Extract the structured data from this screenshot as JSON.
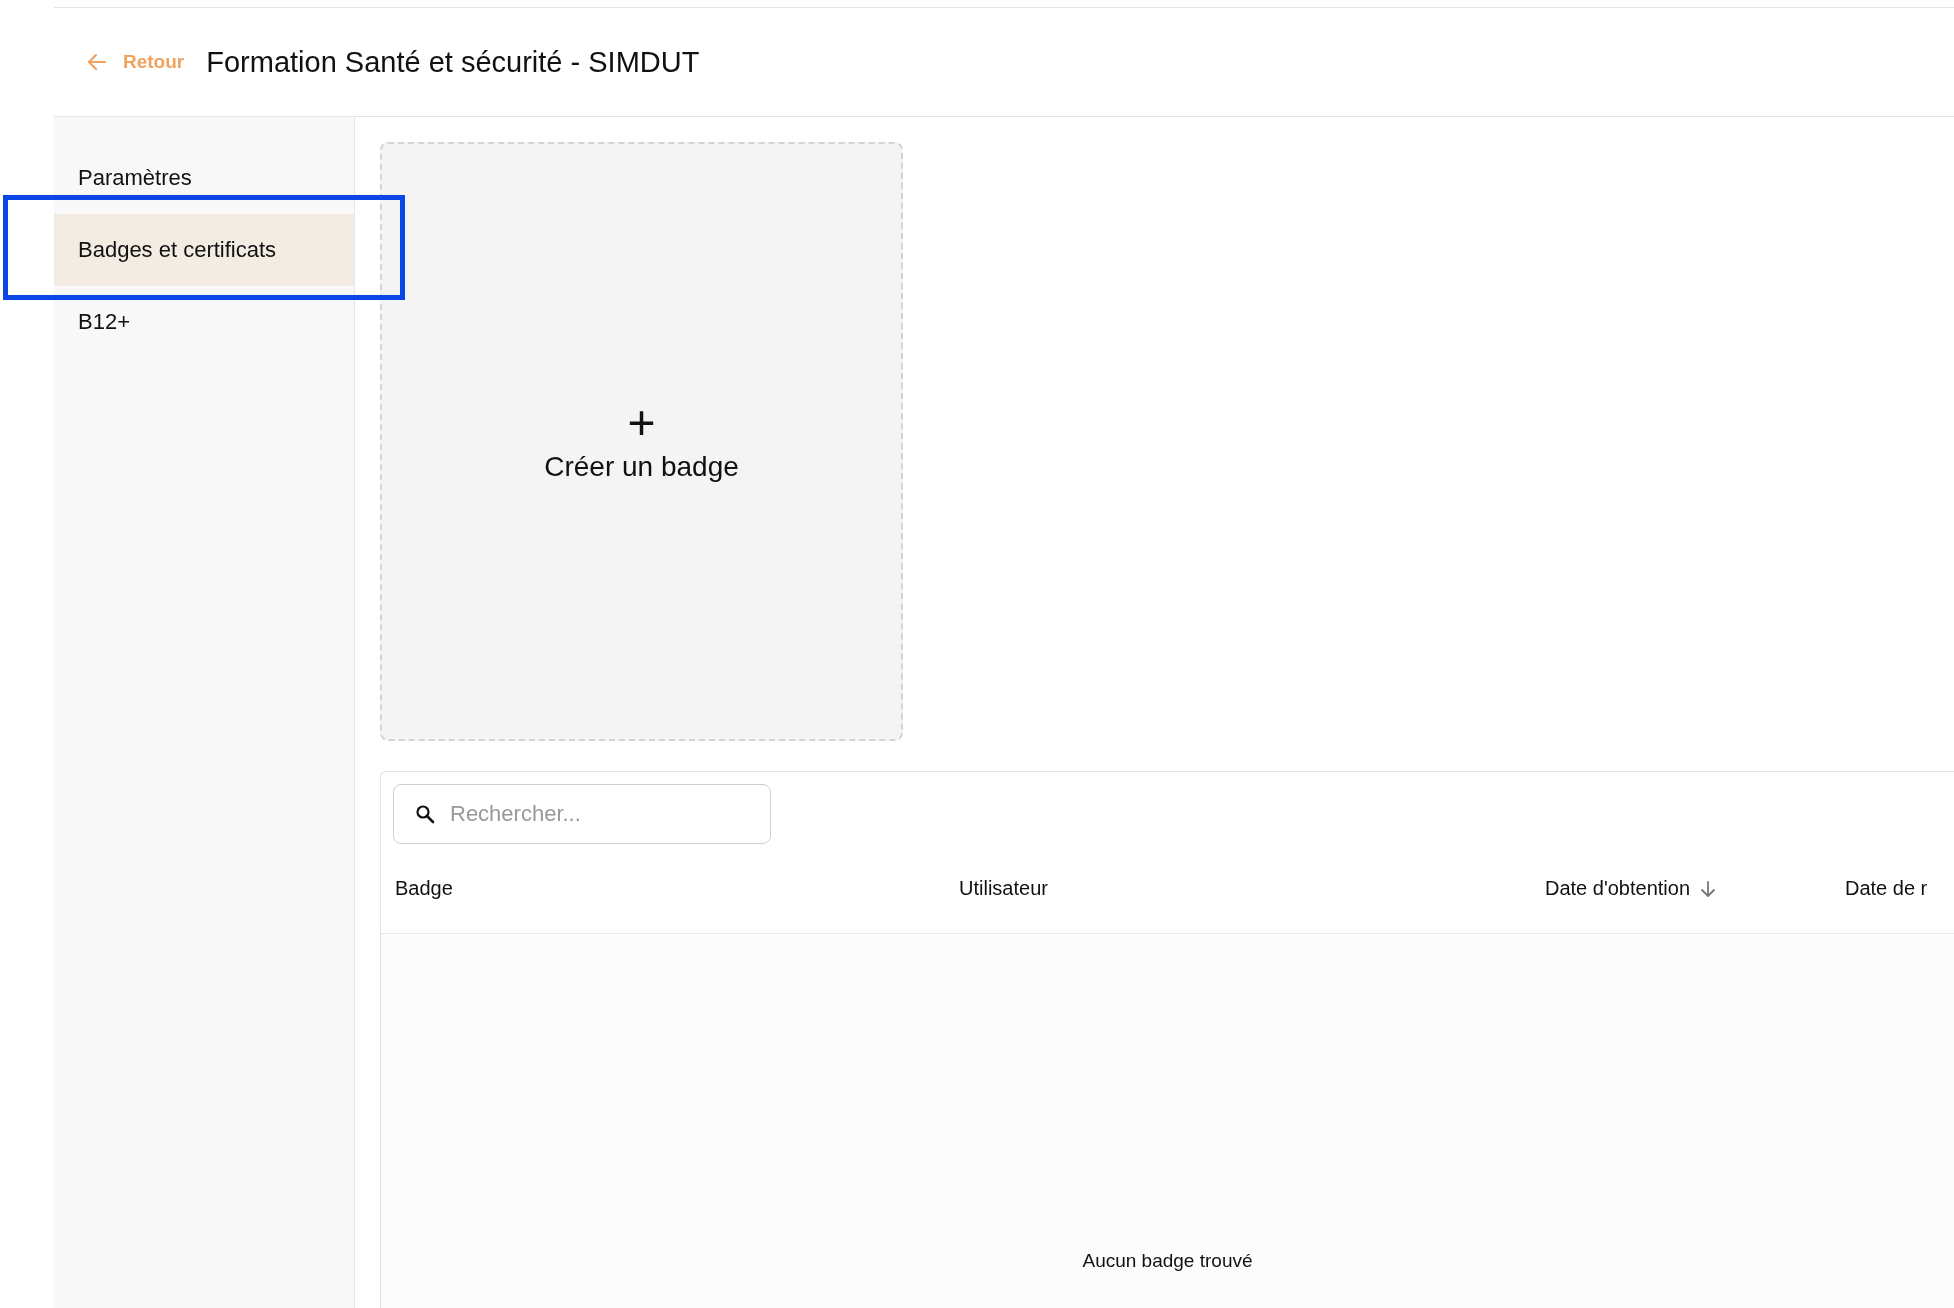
{
  "header": {
    "back_label": "Retour",
    "title": "Formation Santé et sécurité - SIMDUT"
  },
  "sidebar": {
    "items": [
      {
        "label": "Paramètres",
        "selected": false
      },
      {
        "label": "Badges et certificats",
        "selected": true
      },
      {
        "label": "B12+",
        "selected": false
      }
    ]
  },
  "highlight": {
    "on": true
  },
  "create_card": {
    "icon": "+",
    "label": "Créer un badge"
  },
  "table": {
    "search": {
      "placeholder": "Rechercher..."
    },
    "columns": [
      {
        "label": "Badge",
        "sorted": false
      },
      {
        "label": "Utilisateur",
        "sorted": false
      },
      {
        "label": "Date d'obtention",
        "sorted": true
      },
      {
        "label": "Date de r",
        "sorted": false
      }
    ],
    "empty_message": "Aucun badge trouvé"
  }
}
